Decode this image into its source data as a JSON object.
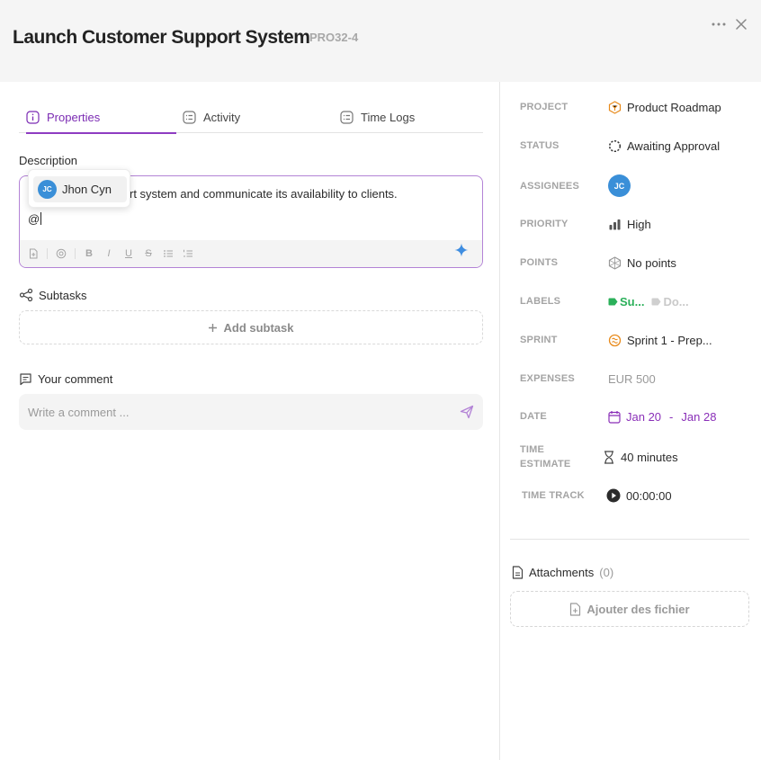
{
  "header": {
    "title": "Launch Customer Support System",
    "task_id": "PRO32-4",
    "more_icon": "more-horizontal-icon",
    "close_icon": "close-icon"
  },
  "tabs": [
    {
      "label": "Properties",
      "icon": "info-icon",
      "active": true
    },
    {
      "label": "Activity",
      "icon": "list-icon",
      "active": false
    },
    {
      "label": "Time Logs",
      "icon": "list-icon",
      "active": false
    }
  ],
  "description": {
    "label": "Description",
    "text_visible": "rt system and communicate its availability to clients.",
    "typing": "@",
    "mention_dropdown": {
      "user_initials": "JC",
      "user_name": "Jhon Cyn"
    },
    "toolbar": [
      "attach-file-icon",
      "mention-icon",
      "bold-icon",
      "italic-icon",
      "underline-icon",
      "strikethrough-icon",
      "bullet-list-icon",
      "numbered-list-icon"
    ],
    "ai_icon": "sparkle-icon"
  },
  "subtasks": {
    "label": "Subtasks",
    "add_label": "Add subtask"
  },
  "comment": {
    "label": "Your comment",
    "placeholder": "Write a comment ..."
  },
  "properties": {
    "project": {
      "label": "PROJECT",
      "value": "Product Roadmap"
    },
    "status": {
      "label": "STATUS",
      "value": "Awaiting Approval"
    },
    "assignees": {
      "label": "ASSIGNEES",
      "initials": "JC"
    },
    "priority": {
      "label": "PRIORITY",
      "value": "High"
    },
    "points": {
      "label": "POINTS",
      "value": "No points"
    },
    "labels": {
      "label": "LABELS",
      "items": [
        {
          "text": "Su...",
          "color": "#2bb05a"
        },
        {
          "text": "Do...",
          "color": "#c9c9c9"
        }
      ]
    },
    "sprint": {
      "label": "SPRINT",
      "value": "Sprint 1 - Prep..."
    },
    "expenses": {
      "label": "EXPENSES",
      "value": "EUR 500"
    },
    "date": {
      "label": "DATE",
      "start": "Jan 20",
      "separator": "-",
      "end": "Jan 28"
    },
    "time_estimate": {
      "label_1": "TIME",
      "label_2": "ESTIMATE",
      "value": "40 minutes"
    },
    "time_track": {
      "label": "TIME TRACK",
      "value": "00:00:00"
    }
  },
  "attachments": {
    "label": "Attachments",
    "count": "(0)",
    "add_label": "Ajouter des fichier"
  },
  "colors": {
    "accent": "#7b2bb3",
    "avatar": "#3a8fd8",
    "sprint": "#e88a1a",
    "date": "#8a2fb8"
  }
}
